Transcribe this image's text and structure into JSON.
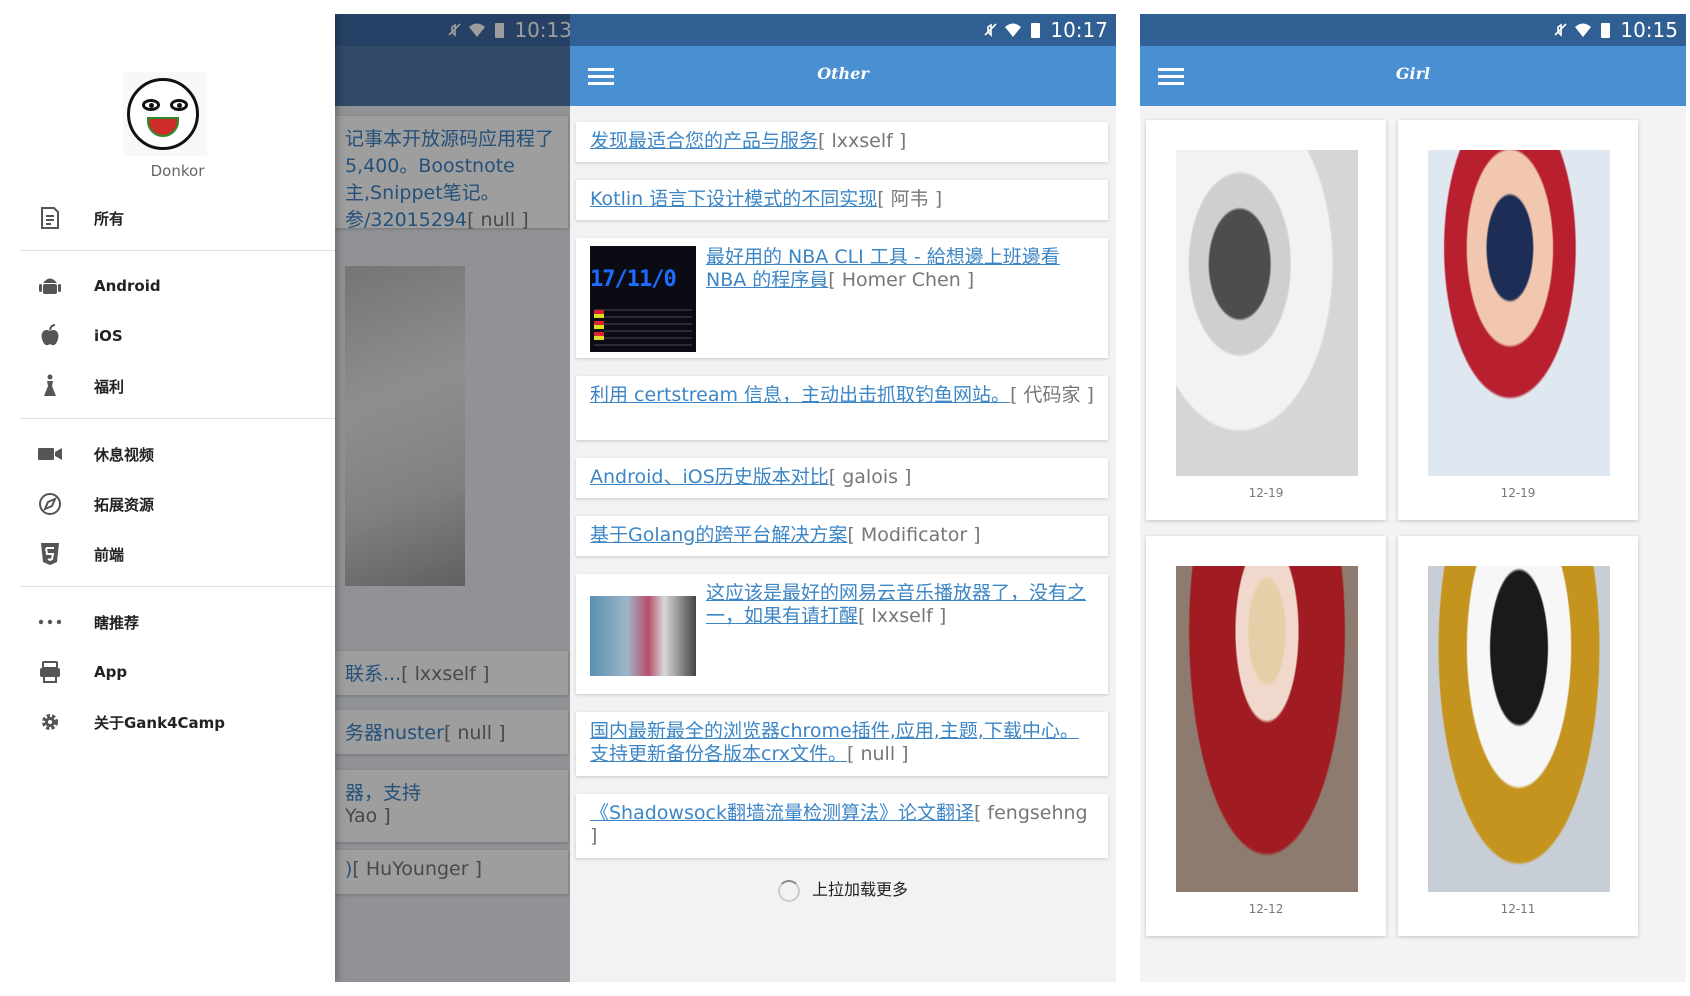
{
  "screen1": {
    "time": "10:13",
    "background_cards": [
      {
        "link": "记事本开放源码应用程了5,400。Boostnote主,Snippet笔记。参/32015294",
        "meta": "[ null ]"
      },
      {
        "link": "联系...",
        "meta": "[ lxxself ]"
      },
      {
        "link": "务器nuster",
        "meta": "[ null ]"
      },
      {
        "link": "器，支持",
        "meta": "Yao ]"
      },
      {
        "link": ")",
        "meta": "[ HuYounger ]"
      }
    ],
    "drawer": {
      "username": "Donkor",
      "items": [
        {
          "label": "所有",
          "icon": "document-icon"
        },
        {
          "label": "Android",
          "icon": "android-icon"
        },
        {
          "label": "iOS",
          "icon": "apple-icon"
        },
        {
          "label": "福利",
          "icon": "dress-icon"
        },
        {
          "label": "休息视频",
          "icon": "video-camera-icon"
        },
        {
          "label": "拓展资源",
          "icon": "explore-icon"
        },
        {
          "label": "前端",
          "icon": "html5-icon"
        },
        {
          "label": "瞎推荐",
          "icon": "more-dots-icon"
        },
        {
          "label": "App",
          "icon": "app-icon"
        },
        {
          "label": "关于Gank4Camp",
          "icon": "gear-icon"
        }
      ]
    }
  },
  "screen2": {
    "time": "10:17",
    "title": "Other",
    "cards": [
      {
        "link": "发现最适合您的产品与服务",
        "who": "[ lxxself ]"
      },
      {
        "link": "Kotlin 语言下设计模式的不同实现",
        "who": "[ 阿韦 ]"
      },
      {
        "link": "最好用的 NBA CLI 工具 - 給想邊上班邊看 NBA 的程序員",
        "who": "[ Homer Chen ]",
        "thumb_text": "17/11/0"
      },
      {
        "link": "利用 certstream 信息，主动出击抓取钓鱼网站。",
        "who": "[ 代码家 ]"
      },
      {
        "link": "Android、iOS历史版本对比",
        "who": "[ galois ]"
      },
      {
        "link": "基于Golang的跨平台解决方案",
        "who": "[ Modificator ]"
      },
      {
        "link": "这应该是最好的网易云音乐播放器了，没有之一，如果有请打醒",
        "who": "[ lxxself ]"
      },
      {
        "link": "国内最新最全的浏览器chrome插件,应用,主题,下载中心。支持更新备份各版本crx文件。",
        "who": "[ null ]"
      },
      {
        "link": "《Shadowsock翻墙流量检测算法》论文翻译",
        "who": "[ fengsehng ]"
      }
    ],
    "load_more": "上拉加载更多"
  },
  "screen3": {
    "time": "10:15",
    "title": "Girl",
    "photos": [
      {
        "date": "12-19"
      },
      {
        "date": "12-19"
      },
      {
        "date": "12-12"
      },
      {
        "date": "12-11"
      }
    ]
  }
}
